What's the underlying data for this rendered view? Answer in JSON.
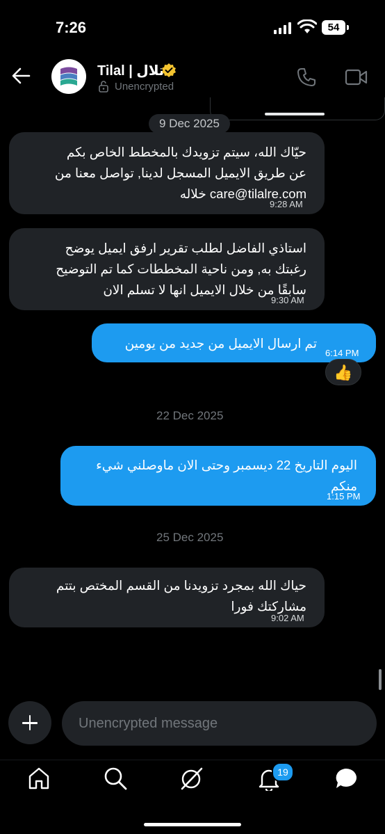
{
  "status": {
    "time": "7:26",
    "battery": "54"
  },
  "header": {
    "name": "Tilal | تلال",
    "status": "Unencrypted"
  },
  "dates": {
    "d1": "9 Dec 2025",
    "d2": "22 Dec 2025",
    "d3": "25 Dec 2025"
  },
  "messages": [
    {
      "side": "in",
      "text": "حيّاك الله،      سيتم تزويدك بالمخطط الخاص بكم\nعن طريق الايميل المسجل لدينا, تواصل معنا من\ncare@tilalre.com خلاله",
      "time": "9:28 AM"
    },
    {
      "side": "in",
      "text": "استاذي الفاضل لطلب تقرير ارفق ايميل يوضح\nرغبتك به, ومن ناحية المخططات كما تم التوضيح\nسابقًا من خلال الايميل انها لا تسلم الان",
      "time": "9:30 AM"
    },
    {
      "side": "out",
      "text": "تم ارسال الايميل من جديد من يومين",
      "time": "6:14 PM",
      "reaction": "👍"
    },
    {
      "side": "out",
      "text": "اليوم التاريخ 22 ديسمبر وحتى الان ماوصلني شيء\nمنكم",
      "time": "1:15 PM"
    },
    {
      "side": "in",
      "text": "حياك الله بمجرد تزويدنا من القسم المختص بتتم\nمشاركتك فورا",
      "time": "9:02 AM"
    }
  ],
  "composer": {
    "placeholder": "Unencrypted message"
  },
  "tabs": {
    "notifications_badge": "19"
  },
  "colors": {
    "accent": "#1d9bf0",
    "bubble_in": "#202327",
    "background": "#000000",
    "verified": "#f4c430"
  }
}
